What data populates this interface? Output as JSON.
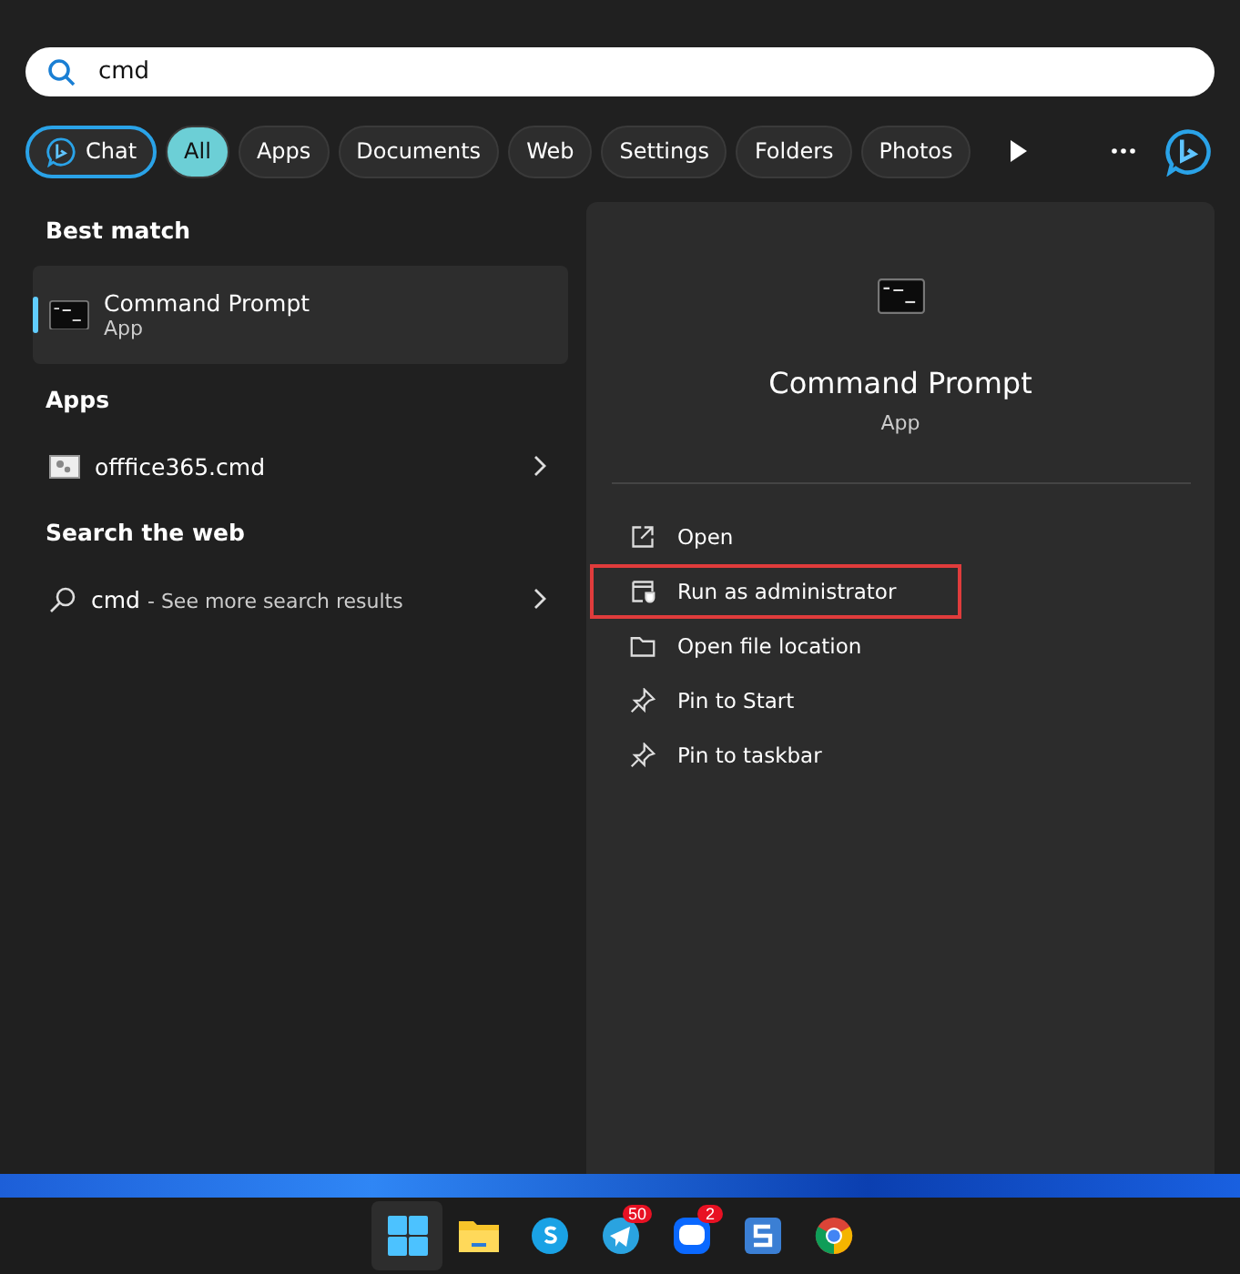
{
  "search": {
    "value": "cmd"
  },
  "filters": [
    {
      "label": "Chat",
      "kind": "chat",
      "selected": false
    },
    {
      "label": "All",
      "kind": "chip",
      "selected": true
    },
    {
      "label": "Apps",
      "kind": "chip",
      "selected": false
    },
    {
      "label": "Documents",
      "kind": "chip",
      "selected": false
    },
    {
      "label": "Web",
      "kind": "chip",
      "selected": false
    },
    {
      "label": "Settings",
      "kind": "chip",
      "selected": false
    },
    {
      "label": "Folders",
      "kind": "chip",
      "selected": false
    },
    {
      "label": "Photos",
      "kind": "chip",
      "selected": false
    }
  ],
  "results": [
    {
      "heading": "Best match",
      "items": [
        {
          "kind": "best",
          "title": "Command Prompt",
          "subtitle": "App",
          "selected": true
        }
      ]
    },
    {
      "heading": "Apps",
      "items": [
        {
          "kind": "file",
          "title": "offfice365.cmd",
          "selected": false
        }
      ]
    },
    {
      "heading": "Search the web",
      "items": [
        {
          "kind": "web",
          "title": "cmd",
          "subtitle": "- See more search results",
          "selected": false
        }
      ]
    }
  ],
  "details": {
    "title": "Command Prompt",
    "subtitle": "App",
    "actions": [
      {
        "label": "Open",
        "kind": "open",
        "highlighted": false
      },
      {
        "label": "Run as administrator",
        "kind": "admin",
        "highlighted": true
      },
      {
        "label": "Open file location",
        "kind": "folder",
        "highlighted": false
      },
      {
        "label": "Pin to Start",
        "kind": "pin",
        "highlighted": false
      },
      {
        "label": "Pin to taskbar",
        "kind": "pin",
        "highlighted": false
      }
    ]
  },
  "taskbar": [
    {
      "kind": "start"
    },
    {
      "kind": "explorer"
    },
    {
      "kind": "skype"
    },
    {
      "kind": "telegram",
      "badge": "50"
    },
    {
      "kind": "zalo",
      "badge": "2"
    },
    {
      "kind": "snagit"
    },
    {
      "kind": "chrome"
    }
  ]
}
